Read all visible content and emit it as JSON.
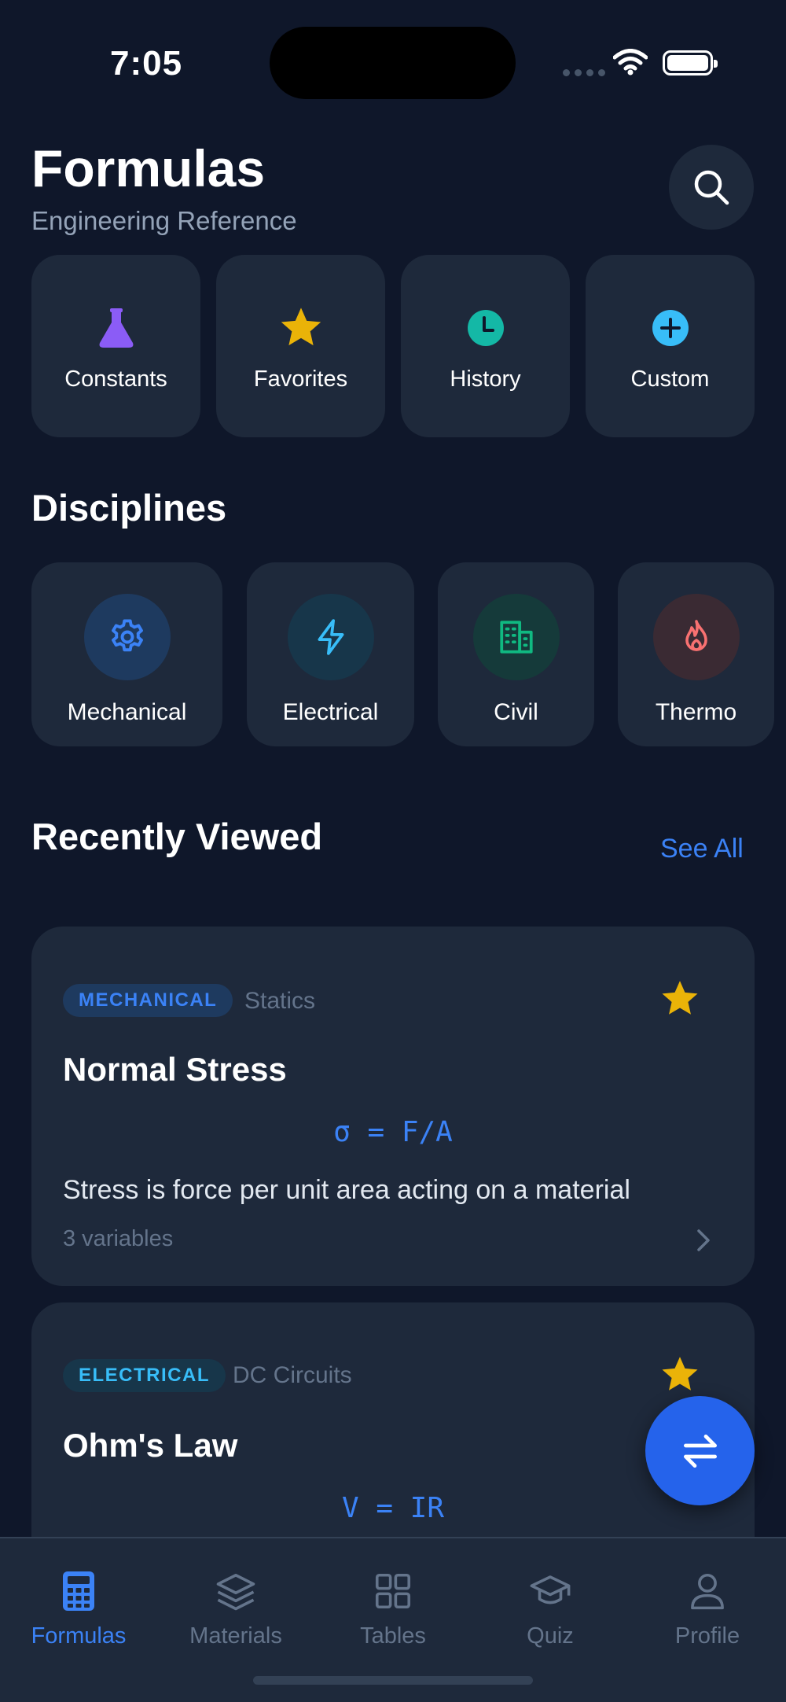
{
  "status": {
    "time": "7:05"
  },
  "header": {
    "title": "Formulas",
    "subtitle": "Engineering Reference",
    "search_icon": "search-icon"
  },
  "quick_actions": [
    {
      "label": "Constants",
      "icon": "flask-icon",
      "color": "#8b5cf6"
    },
    {
      "label": "Favorites",
      "icon": "star-icon",
      "color": "#eab308"
    },
    {
      "label": "History",
      "icon": "clock-icon",
      "color": "#14b8a6"
    },
    {
      "label": "Custom",
      "icon": "plus-circle-icon",
      "color": "#38bdf8"
    }
  ],
  "disciplines": {
    "title": "Disciplines",
    "items": [
      {
        "label": "Mechanical",
        "icon": "gear-icon",
        "color": "#3b82f6"
      },
      {
        "label": "Electrical",
        "icon": "lightning-icon",
        "color": "#38bdf8"
      },
      {
        "label": "Civil",
        "icon": "building-icon",
        "color": "#10b981"
      },
      {
        "label": "Thermo",
        "icon": "flame-icon",
        "color": "#f87171"
      }
    ]
  },
  "recent": {
    "title": "Recently Viewed",
    "see_all": "See All",
    "items": [
      {
        "tag": "MECHANICAL",
        "subcategory": "Statics",
        "name": "Normal Stress",
        "equation": "σ = F/A",
        "description": "Stress is force per unit area acting on a material",
        "variables": "3 variables",
        "favorite": true
      },
      {
        "tag": "ELECTRICAL",
        "subcategory": "DC Circuits",
        "name": "Ohm's Law",
        "equation": "V = IR",
        "favorite": true
      }
    ]
  },
  "fab": {
    "icon": "swap-arrows-icon"
  },
  "tabbar": [
    {
      "label": "Formulas",
      "icon": "calculator-icon",
      "active": true
    },
    {
      "label": "Materials",
      "icon": "layers-icon",
      "active": false
    },
    {
      "label": "Tables",
      "icon": "grid-icon",
      "active": false
    },
    {
      "label": "Quiz",
      "icon": "graduation-cap-icon",
      "active": false
    },
    {
      "label": "Profile",
      "icon": "person-icon",
      "active": false
    }
  ],
  "colors": {
    "accent": "#3b82f6",
    "background": "#0f172a",
    "card": "#1e293b",
    "star": "#eab308"
  }
}
